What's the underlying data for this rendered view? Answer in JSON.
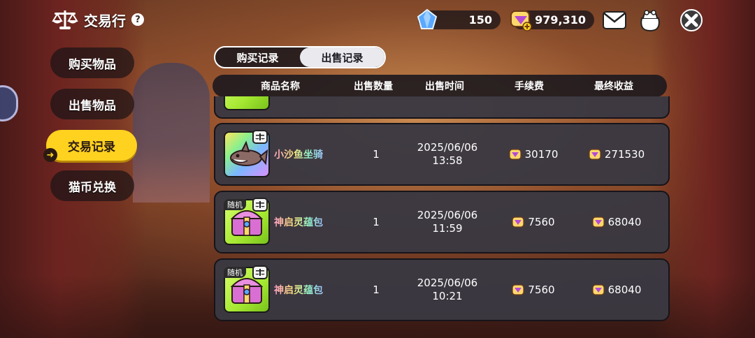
{
  "header": {
    "title": "交易行",
    "help_icon": "help-icon",
    "gem_count": "150",
    "coin_count": "979,310"
  },
  "sidebar": {
    "items": [
      {
        "label": "购买物品",
        "active": false
      },
      {
        "label": "出售物品",
        "active": false
      },
      {
        "label": "交易记录",
        "active": true
      },
      {
        "label": "猫币兑换",
        "active": false
      }
    ]
  },
  "tabs": [
    {
      "label": "购买记录",
      "active": false
    },
    {
      "label": "出售记录",
      "active": true
    }
  ],
  "table": {
    "columns": [
      "商品名称",
      "出售数量",
      "出售时间",
      "手续费",
      "最终收益"
    ],
    "rows": [
      {
        "name": "小沙鱼坐骑",
        "qty": "1",
        "date": "2025/06/06",
        "time": "13:58",
        "fee": "30170",
        "net": "271530",
        "tag": ""
      },
      {
        "name": "神启灵蕴包",
        "qty": "1",
        "date": "2025/06/06",
        "time": "11:59",
        "fee": "7560",
        "net": "68040",
        "tag": "随机"
      },
      {
        "name": "神启灵蕴包",
        "qty": "1",
        "date": "2025/06/06",
        "time": "10:21",
        "fee": "7560",
        "net": "68040",
        "tag": "随机"
      }
    ]
  },
  "colors": {
    "active_yellow": "#ffd21f",
    "row_bg": "#3a3842",
    "gem_blue": "#5aa8ff",
    "coin_purple": "#b44bd6"
  }
}
